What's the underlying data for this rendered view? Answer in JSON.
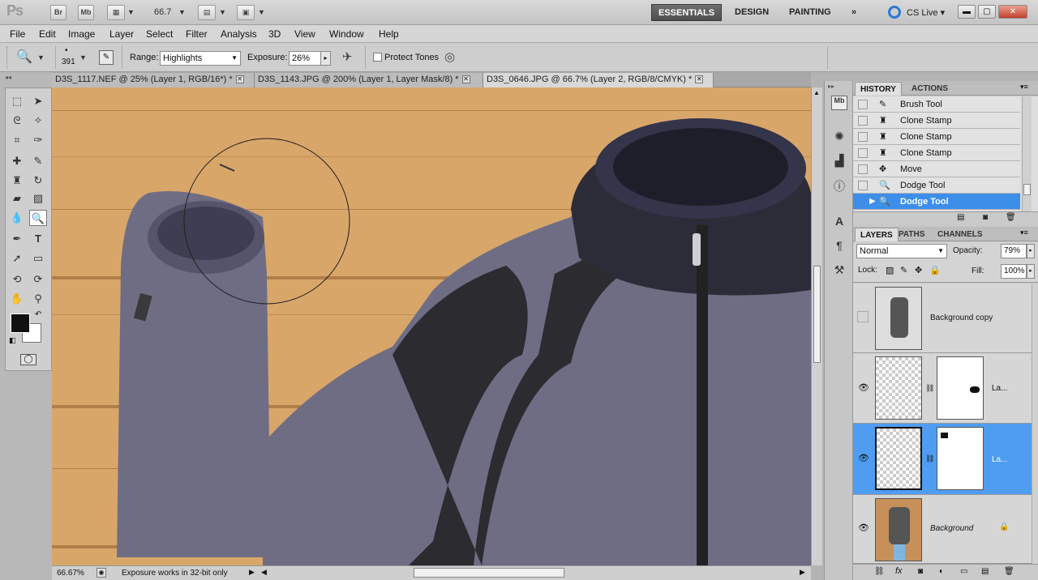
{
  "app": {
    "logo": "Ps",
    "bridge_btn": "Br",
    "minibridge_btn": "Mb",
    "zoom_value": "66.7",
    "workspaces": [
      "ESSENTIALS",
      "DESIGN",
      "PAINTING"
    ],
    "more": "»",
    "cs_live": "CS Live"
  },
  "menu": [
    "File",
    "Edit",
    "Image",
    "Layer",
    "Select",
    "Filter",
    "Analysis",
    "3D",
    "View",
    "Window",
    "Help"
  ],
  "options": {
    "brush_size": "391",
    "range_label": "Range:",
    "range_value": "Highlights",
    "exposure_label": "Exposure:",
    "exposure_value": "26%",
    "protect_tones": "Protect Tones"
  },
  "tabs": [
    {
      "label": "D3S_1117.NEF @ 25% (Layer 1, RGB/16*) *"
    },
    {
      "label": "D3S_1143.JPG @ 200% (Layer 1, Layer Mask/8) *"
    },
    {
      "label": "D3S_0646.JPG @ 66.7% (Layer 2, RGB/8/CMYK) *"
    }
  ],
  "status": {
    "zoom": "66.67%",
    "message": "Exposure works in 32-bit only"
  },
  "history": {
    "tabs": [
      "HISTORY",
      "ACTIONS"
    ],
    "items": [
      "Brush Tool",
      "Clone Stamp",
      "Clone Stamp",
      "Clone Stamp",
      "Move",
      "Dodge Tool",
      "Dodge Tool"
    ]
  },
  "layers": {
    "tabs": [
      "LAYERS",
      "PATHS",
      "CHANNELS"
    ],
    "blend": "Normal",
    "opacity_label": "Opacity:",
    "opacity": "79%",
    "lock_label": "Lock:",
    "fill_label": "Fill:",
    "fill": "100%",
    "items": [
      {
        "name": "Background copy"
      },
      {
        "name": "La..."
      },
      {
        "name": "La..."
      },
      {
        "name": "Background"
      }
    ]
  },
  "colors": {
    "accent": "#3d8ee8",
    "wood": "#d9a66a",
    "fleece": "#6f6d84"
  }
}
